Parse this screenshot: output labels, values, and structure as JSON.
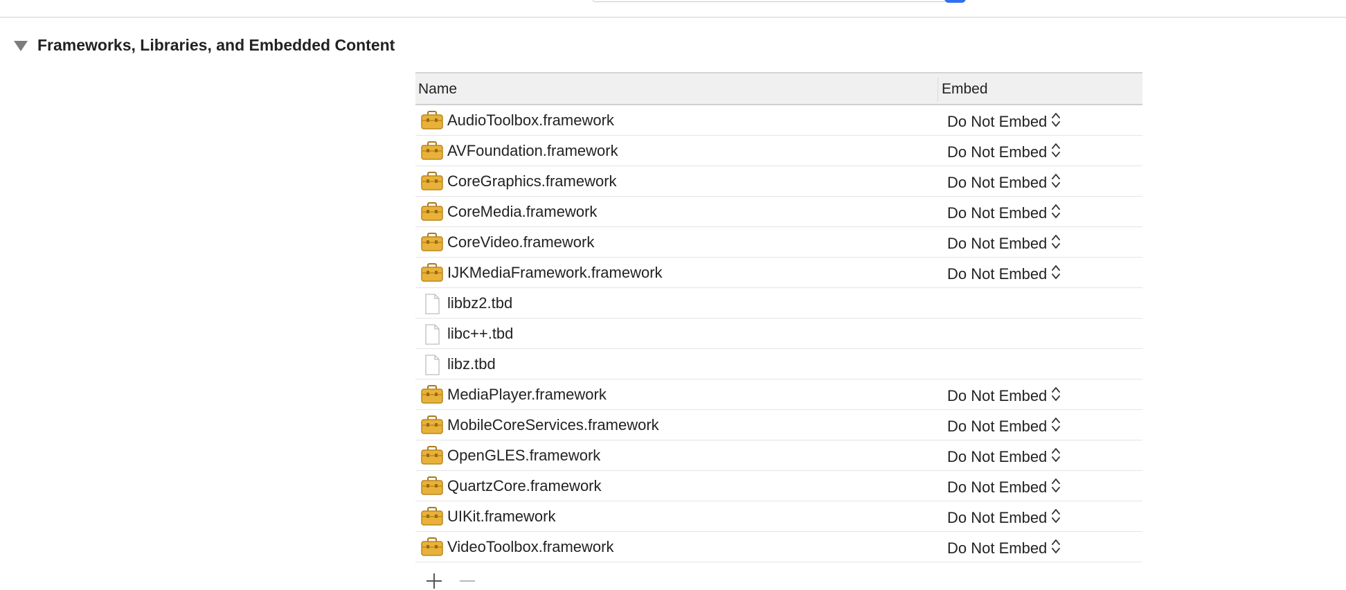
{
  "section": {
    "title": "Frameworks, Libraries, and Embedded Content"
  },
  "table": {
    "columns": {
      "name": "Name",
      "embed": "Embed"
    },
    "rows": [
      {
        "name": "AudioToolbox.framework",
        "icon": "framework-icon",
        "embed": "Do Not Embed"
      },
      {
        "name": "AVFoundation.framework",
        "icon": "framework-icon",
        "embed": "Do Not Embed"
      },
      {
        "name": "CoreGraphics.framework",
        "icon": "framework-icon",
        "embed": "Do Not Embed"
      },
      {
        "name": "CoreMedia.framework",
        "icon": "framework-icon",
        "embed": "Do Not Embed"
      },
      {
        "name": "CoreVideo.framework",
        "icon": "framework-icon",
        "embed": "Do Not Embed"
      },
      {
        "name": "IJKMediaFramework.framework",
        "icon": "framework-icon",
        "embed": "Do Not Embed"
      },
      {
        "name": "libbz2.tbd",
        "icon": "file-icon",
        "embed": ""
      },
      {
        "name": "libc++.tbd",
        "icon": "file-icon",
        "embed": ""
      },
      {
        "name": "libz.tbd",
        "icon": "file-icon",
        "embed": ""
      },
      {
        "name": "MediaPlayer.framework",
        "icon": "framework-icon",
        "embed": "Do Not Embed"
      },
      {
        "name": "MobileCoreServices.framework",
        "icon": "framework-icon",
        "embed": "Do Not Embed"
      },
      {
        "name": "OpenGLES.framework",
        "icon": "framework-icon",
        "embed": "Do Not Embed"
      },
      {
        "name": "QuartzCore.framework",
        "icon": "framework-icon",
        "embed": "Do Not Embed"
      },
      {
        "name": "UIKit.framework",
        "icon": "framework-icon",
        "embed": "Do Not Embed"
      },
      {
        "name": "VideoToolbox.framework",
        "icon": "framework-icon",
        "embed": "Do Not Embed"
      }
    ]
  },
  "toolbar": {
    "add_icon": "plus-icon",
    "remove_icon": "minus-icon"
  },
  "colors": {
    "accent": "#2f6ff0",
    "framework_icon": "#e8b23a"
  }
}
